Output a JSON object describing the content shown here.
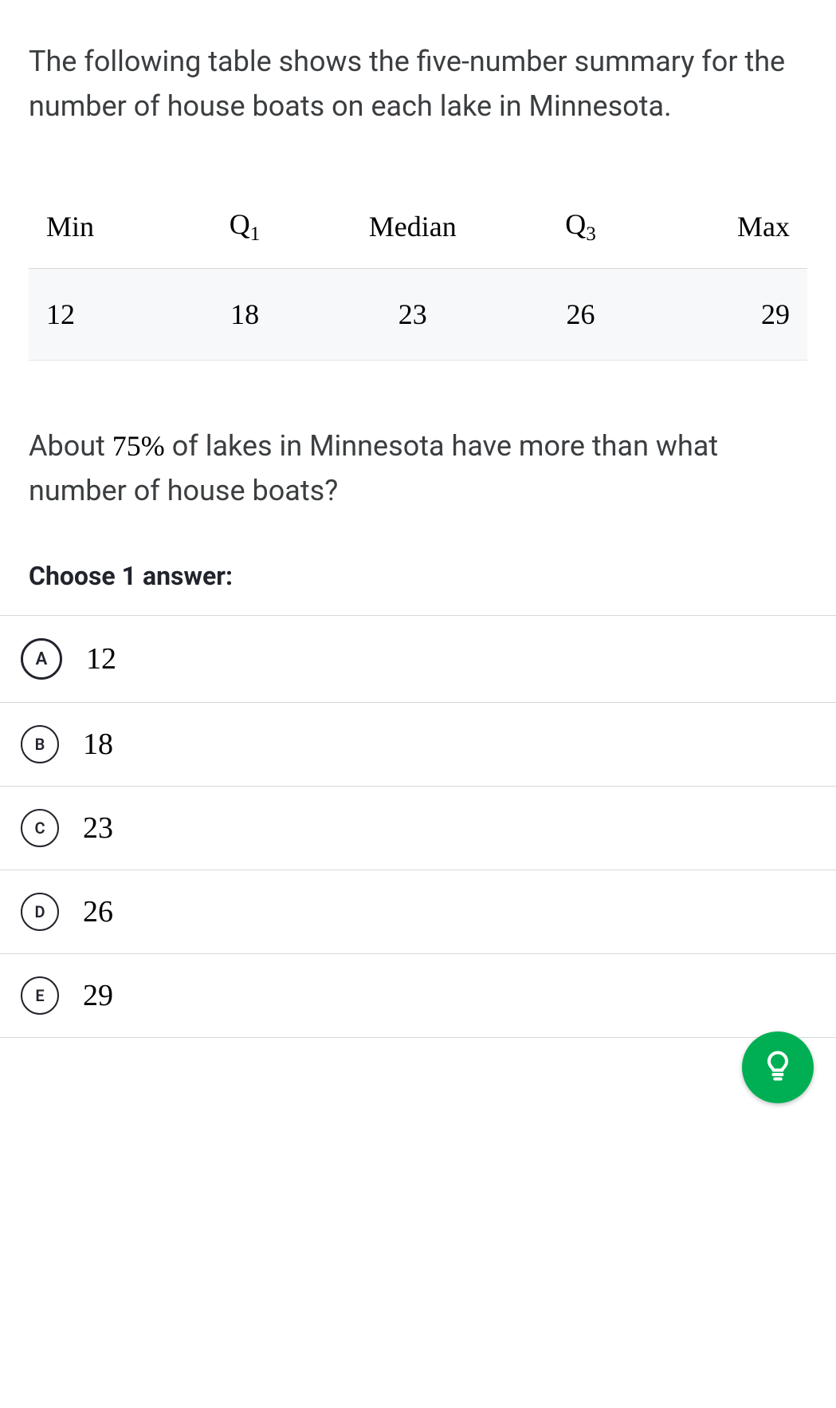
{
  "intro": "The following table shows the five-number summary for the number of house boats on each lake in Minnesota.",
  "table": {
    "headers": {
      "min": "Min",
      "q1": "Q",
      "q1sub": "1",
      "median": "Median",
      "q3": "Q",
      "q3sub": "3",
      "max": "Max"
    },
    "values": {
      "min": "12",
      "q1": "18",
      "median": "23",
      "q3": "26",
      "max": "29"
    }
  },
  "question_pre": "About ",
  "question_pct": "75%",
  "question_post": " of lakes in Minnesota have more than what number of house boats?",
  "choose_label": "Choose 1 answer:",
  "answers": [
    {
      "letter": "A",
      "value": "12"
    },
    {
      "letter": "B",
      "value": "18"
    },
    {
      "letter": "C",
      "value": "23"
    },
    {
      "letter": "D",
      "value": "26"
    },
    {
      "letter": "E",
      "value": "29"
    }
  ],
  "chart_data": {
    "type": "table",
    "title": "Five-number summary: house boats per lake in Minnesota",
    "columns": [
      "Min",
      "Q1",
      "Median",
      "Q3",
      "Max"
    ],
    "rows": [
      [
        12,
        18,
        23,
        26,
        29
      ]
    ]
  }
}
